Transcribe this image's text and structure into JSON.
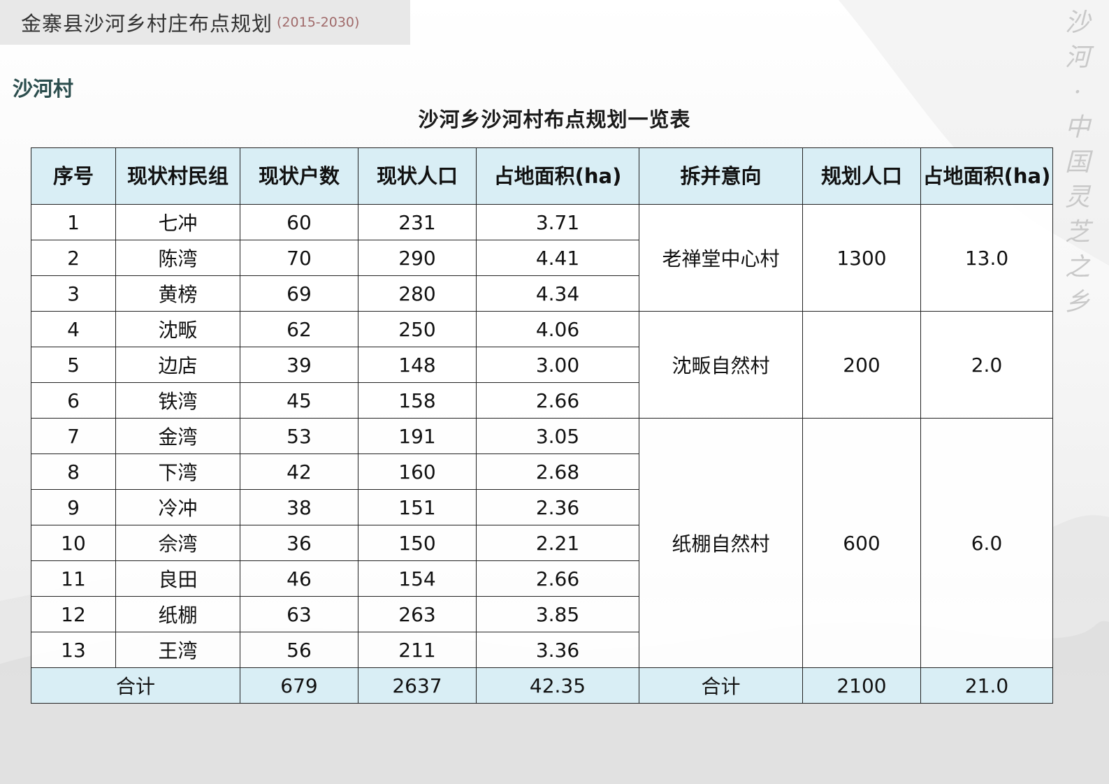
{
  "header": {
    "title": "金寨县沙河乡村庄布点规划",
    "years": "(2015-2030)"
  },
  "section_title": "沙河村",
  "table_title": "沙河乡沙河村布点规划一览表",
  "watermark": [
    "沙",
    "河",
    "·",
    "中",
    "国",
    "灵",
    "芝",
    "之",
    "乡"
  ],
  "table": {
    "headers": {
      "index": "序号",
      "group": "现状村民组",
      "households": "现状户数",
      "population": "现状人口",
      "area": "占地面积(ha)",
      "merge": "拆并意向",
      "plan_population": "规划人口",
      "plan_area": "占地面积(ha)"
    },
    "rows": [
      {
        "index": "1",
        "group": "七冲",
        "households": "60",
        "population": "231",
        "area": "3.71"
      },
      {
        "index": "2",
        "group": "陈湾",
        "households": "70",
        "population": "290",
        "area": "4.41"
      },
      {
        "index": "3",
        "group": "黄榜",
        "households": "69",
        "population": "280",
        "area": "4.34"
      },
      {
        "index": "4",
        "group": "沈畈",
        "households": "62",
        "population": "250",
        "area": "4.06"
      },
      {
        "index": "5",
        "group": "边店",
        "households": "39",
        "population": "148",
        "area": "3.00"
      },
      {
        "index": "6",
        "group": "铁湾",
        "households": "45",
        "population": "158",
        "area": "2.66"
      },
      {
        "index": "7",
        "group": "金湾",
        "households": "53",
        "population": "191",
        "area": "3.05"
      },
      {
        "index": "8",
        "group": "下湾",
        "households": "42",
        "population": "160",
        "area": "2.68"
      },
      {
        "index": "9",
        "group": "冷冲",
        "households": "38",
        "population": "151",
        "area": "2.36"
      },
      {
        "index": "10",
        "group": "佘湾",
        "households": "36",
        "population": "150",
        "area": "2.21"
      },
      {
        "index": "11",
        "group": "良田",
        "households": "46",
        "population": "154",
        "area": "2.66"
      },
      {
        "index": "12",
        "group": "纸棚",
        "households": "63",
        "population": "263",
        "area": "3.85"
      },
      {
        "index": "13",
        "group": "王湾",
        "households": "56",
        "population": "211",
        "area": "3.36"
      }
    ],
    "groups": [
      {
        "merge": "老禅堂中心村",
        "plan_population": "1300",
        "plan_area": "13.0"
      },
      {
        "merge": "沈畈自然村",
        "plan_population": "200",
        "plan_area": "2.0"
      },
      {
        "merge": "纸棚自然村",
        "plan_population": "600",
        "plan_area": "6.0"
      }
    ],
    "total": {
      "label": "合计",
      "households": "679",
      "population": "2637",
      "area": "42.35",
      "merge_label": "合计",
      "plan_population": "2100",
      "plan_area": "21.0"
    }
  }
}
